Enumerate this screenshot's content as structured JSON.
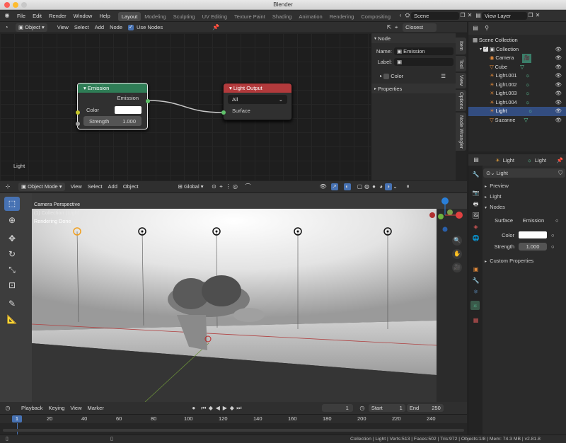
{
  "window": {
    "title": "Blender"
  },
  "menu": {
    "file": "File",
    "edit": "Edit",
    "render": "Render",
    "window": "Window",
    "help": "Help"
  },
  "workspaces": [
    "Layout",
    "Modeling",
    "Sculpting",
    "UV Editing",
    "Texture Paint",
    "Shading",
    "Animation",
    "Rendering",
    "Compositing"
  ],
  "scene": {
    "name": "Scene",
    "view_layer": "View Layer"
  },
  "node_header": {
    "type": "Object",
    "view": "View",
    "select": "Select",
    "add": "Add",
    "node": "Node",
    "use_nodes": "Use Nodes",
    "snap": "Closest"
  },
  "nodes": {
    "emission": {
      "title": "Emission",
      "output": "Emission",
      "color_label": "Color",
      "strength_label": "Strength",
      "strength_value": "1.000"
    },
    "light_output": {
      "title": "Light Output",
      "target": "All",
      "surface": "Surface"
    }
  },
  "node_editor_label": "Light",
  "npanel": {
    "section": "Node",
    "name_label": "Name:",
    "name_value": "Emission",
    "label_label": "Label:",
    "label_value": "",
    "color": "Color",
    "properties": "Properties",
    "tabs": [
      "Item",
      "Tool",
      "View",
      "Options",
      "Node Wrangler"
    ]
  },
  "viewport_header": {
    "mode": "Object Mode",
    "view": "View",
    "select": "Select",
    "add": "Add",
    "object": "Object",
    "orientation": "Global"
  },
  "viewport_overlay": {
    "line1": "Camera Perspective",
    "line2": "(1) Collection | Light",
    "line3": "Rendering Done"
  },
  "outliner": {
    "root": "Scene Collection",
    "collection": "Collection",
    "items": [
      "Camera",
      "Cube",
      "Light.001",
      "Light.002",
      "Light.003",
      "Light.004",
      "Light",
      "Suzanne"
    ]
  },
  "properties": {
    "object_name": "Light",
    "data_name": "Light",
    "datablock": "Light",
    "preview": "Preview",
    "light": "Light",
    "nodes": "Nodes",
    "surface_label": "Surface",
    "surface_value": "Emission",
    "color_label": "Color",
    "strength_label": "Strength",
    "strength_value": "1.000",
    "custom": "Custom Properties"
  },
  "timeline": {
    "playback": "Playback",
    "keying": "Keying",
    "view": "View",
    "marker": "Marker",
    "current_frame": "1",
    "start_label": "Start",
    "start_value": "1",
    "end_label": "End",
    "end_value": "250",
    "ticks": [
      "1",
      "20",
      "40",
      "60",
      "80",
      "100",
      "120",
      "140",
      "160",
      "180",
      "200",
      "220",
      "240"
    ]
  },
  "status": "Collection | Light | Verts:513 | Faces:502 | Tris:972 | Objects:1/8 | Mem: 74.3 MB | v2.81.8",
  "colors": {
    "emission_header": "#2f7d56",
    "output_header": "#b23a3c",
    "accent_blue": "#4772b3",
    "selected_row": "#334d80"
  }
}
